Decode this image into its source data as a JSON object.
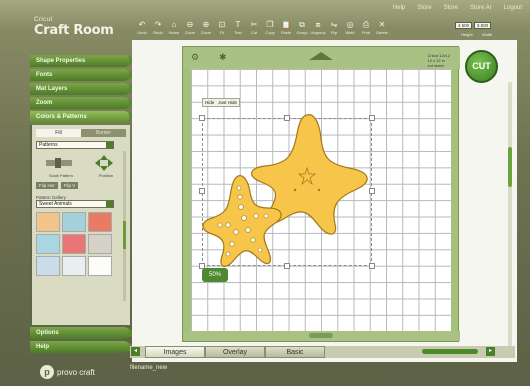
{
  "app": {
    "brand": "Cricut",
    "name": "Craft Room"
  },
  "top_links": [
    "Help",
    "Store",
    "Store",
    "Store Ar",
    "Logout"
  ],
  "toolbar": {
    "tools": [
      {
        "icon": "undo-icon",
        "label": "Undo",
        "glyph": "↶"
      },
      {
        "icon": "redo-icon",
        "label": "Redo",
        "glyph": "↷"
      },
      {
        "icon": "home-icon",
        "label": "Home",
        "glyph": "⌂"
      },
      {
        "icon": "zoom-out-icon",
        "label": "Zoom",
        "glyph": "⊖"
      },
      {
        "icon": "zoom-in-icon",
        "label": "Zoom",
        "glyph": "⊕"
      },
      {
        "icon": "fit-icon",
        "label": "Fit",
        "glyph": "⊡"
      },
      {
        "icon": "text-icon",
        "label": "Text",
        "glyph": "T"
      },
      {
        "icon": "cut-tool-icon",
        "label": "Cut",
        "glyph": "✂"
      },
      {
        "icon": "copy-icon",
        "label": "Copy",
        "glyph": "❐"
      },
      {
        "icon": "paste-icon",
        "label": "Paste",
        "glyph": "📋"
      },
      {
        "icon": "group-icon",
        "label": "Group",
        "glyph": "⧉"
      },
      {
        "icon": "ungroup-icon",
        "label": "Ungroup",
        "glyph": "⧈"
      },
      {
        "icon": "flip-icon",
        "label": "Flip",
        "glyph": "⇋"
      },
      {
        "icon": "weld-icon",
        "label": "Weld",
        "glyph": "◎"
      },
      {
        "icon": "print-icon",
        "label": "Print",
        "glyph": "⎙"
      },
      {
        "icon": "delete-icon",
        "label": "Delete",
        "glyph": "✕"
      }
    ],
    "width_value": "4.500",
    "height_value": "3.500",
    "width_label": "Height",
    "height_label": "Width"
  },
  "sidebar": {
    "items": [
      {
        "label": "Shape Properties"
      },
      {
        "label": "Fonts"
      },
      {
        "label": "Mat Layers"
      },
      {
        "label": "Zoom"
      },
      {
        "label": "Colors & Patterns",
        "active": true
      }
    ],
    "panel": {
      "tab_fill": "Fill",
      "tab_border": "Border",
      "fill_select": "Patterns",
      "scale_label": "Scale Pattern",
      "position_label": "Position",
      "flip_h": "Flip Hor",
      "flip_v": "Flip V",
      "gallery_label": "Pattern Gallery",
      "gallery_select": "Sweet Animals",
      "swatches": [
        "#f0c48a",
        "#a6d0dc",
        "#e97a63",
        "#a9d6e0",
        "#e97676",
        "#d6d2c8",
        "#c8dde8",
        "#e9eef0",
        "#fdfdf8"
      ]
    },
    "bottom_items": [
      {
        "label": "Options"
      },
      {
        "label": "Help"
      }
    ]
  },
  "mat": {
    "info_line1": "Cricut 12x12",
    "info_line2": "12 x 12 in",
    "info_line3": "cut sheet"
  },
  "mini_panel": {
    "item1": "Hide",
    "item2": "Just Hide"
  },
  "zoom_badge": "50%",
  "cut_button": "CUT",
  "bottom_tabs": [
    "Images",
    "Overlay",
    "Basic"
  ],
  "footer": {
    "filename": "filename_new",
    "company": "provo craft",
    "company_initial": "p"
  },
  "colors": {
    "star_fill": "#f6c54a",
    "star_stroke": "#a07a1a",
    "accent_green": "#4f7c2a"
  }
}
